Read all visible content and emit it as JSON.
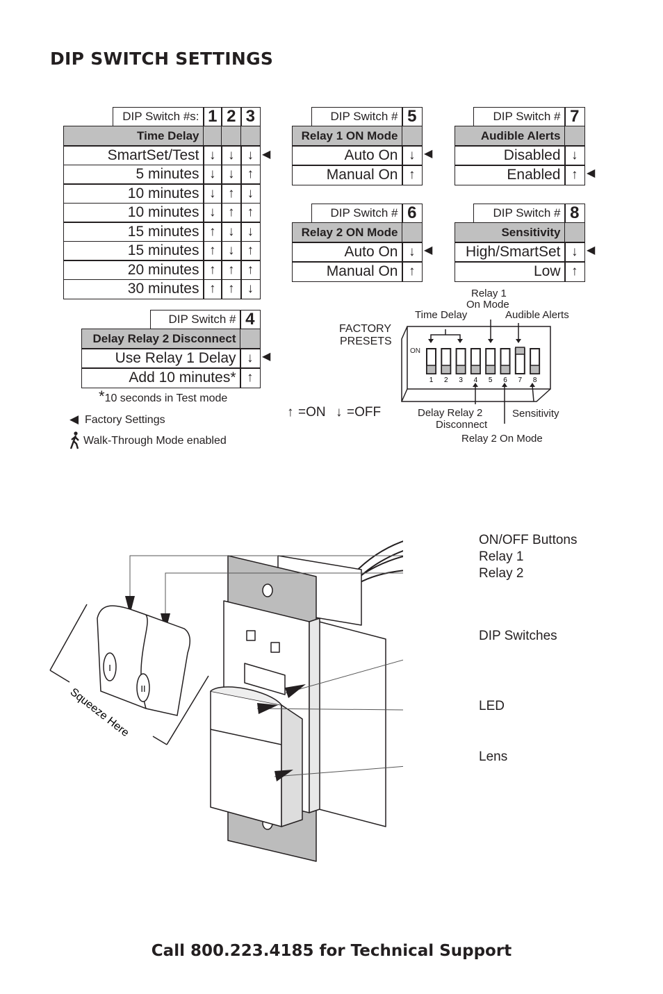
{
  "title": "DIP SWITCH SETTINGS",
  "footer": "Call 800.223.4185 for Technical Support",
  "arrows": {
    "on": "↑",
    "off": "↓",
    "factory": "◀"
  },
  "time_delay_table": {
    "header_label": "DIP Switch #s:",
    "switch_numbers": [
      "1",
      "2",
      "3"
    ],
    "section": "Time Delay",
    "rows": [
      {
        "label": "SmartSet/Test",
        "walk": true,
        "states": [
          "off",
          "off",
          "off"
        ],
        "factory": true
      },
      {
        "label": "5 minutes",
        "walk": false,
        "states": [
          "off",
          "off",
          "on"
        ],
        "factory": false
      },
      {
        "label": "10 minutes",
        "walk": true,
        "states": [
          "off",
          "on",
          "off"
        ],
        "factory": false
      },
      {
        "label": "10 minutes",
        "walk": false,
        "states": [
          "off",
          "on",
          "on"
        ],
        "factory": false
      },
      {
        "label": "15 minutes",
        "walk": true,
        "states": [
          "on",
          "off",
          "off"
        ],
        "factory": false
      },
      {
        "label": "15 minutes",
        "walk": false,
        "states": [
          "on",
          "off",
          "on"
        ],
        "factory": false
      },
      {
        "label": "20 minutes",
        "walk": false,
        "states": [
          "on",
          "on",
          "on"
        ],
        "factory": false
      },
      {
        "label": "30 minutes",
        "walk": true,
        "states": [
          "on",
          "on",
          "off"
        ],
        "factory": false
      }
    ]
  },
  "switch4_table": {
    "header_label": "DIP Switch #",
    "switch_number": "4",
    "section": "Delay Relay 2 Disconnect",
    "rows": [
      {
        "label": "Use Relay 1 Delay",
        "state": "off",
        "factory": true
      },
      {
        "label": "Add 10 minutes*",
        "state": "on",
        "factory": false
      }
    ],
    "footnote_mark": "*",
    "footnote": "10 seconds in Test mode"
  },
  "switch5_table": {
    "header_label": "DIP Switch #",
    "switch_number": "5",
    "section": "Relay 1 ON Mode",
    "rows": [
      {
        "label": "Auto On",
        "state": "off",
        "factory": true
      },
      {
        "label": "Manual On",
        "state": "on",
        "factory": false
      }
    ]
  },
  "switch6_table": {
    "header_label": "DIP Switch #",
    "switch_number": "6",
    "section": "Relay 2 ON Mode",
    "rows": [
      {
        "label": "Auto On",
        "state": "off",
        "factory": true
      },
      {
        "label": "Manual On",
        "state": "on",
        "factory": false
      }
    ]
  },
  "switch7_table": {
    "header_label": "DIP Switch #",
    "switch_number": "7",
    "section": "Audible Alerts",
    "rows": [
      {
        "label": "Disabled",
        "state": "off",
        "factory": false
      },
      {
        "label": "Enabled",
        "state": "on",
        "factory": true
      }
    ]
  },
  "switch8_table": {
    "header_label": "DIP Switch #",
    "switch_number": "8",
    "section": "Sensitivity",
    "rows": [
      {
        "label": "High/SmartSet",
        "state": "off",
        "factory": true
      },
      {
        "label": "Low",
        "state": "on",
        "factory": false
      }
    ]
  },
  "legend": {
    "factory_settings": "Factory Settings",
    "walk_through": "Walk-Through Mode enabled",
    "on_text": "=ON",
    "off_text": "=OFF"
  },
  "factory_presets": {
    "title_line1": "FACTORY",
    "title_line2": "PRESETS",
    "on_label": "ON",
    "switch_labels": [
      "1",
      "2",
      "3",
      "4",
      "5",
      "6",
      "7",
      "8"
    ],
    "switch_states": [
      "off",
      "off",
      "off",
      "off",
      "off",
      "off",
      "on",
      "off"
    ],
    "callouts": {
      "time_delay": "Time Delay",
      "relay1_line1": "Relay 1",
      "relay1_line2": "On Mode",
      "audible_alerts": "Audible Alerts",
      "delay_relay2_line1": "Delay Relay 2",
      "delay_relay2_line2": "Disconnect",
      "sensitivity": "Sensitivity",
      "relay2_on_mode": "Relay 2 On Mode"
    }
  },
  "device_diagram": {
    "on_off_buttons": "ON/OFF Buttons",
    "relay1": "Relay 1",
    "relay2": "Relay 2",
    "dip_switches": "DIP Switches",
    "led": "LED",
    "lens": "Lens",
    "squeeze_here": "Squeeze Here",
    "button1_glyph": "I",
    "button2_glyph": "II"
  }
}
